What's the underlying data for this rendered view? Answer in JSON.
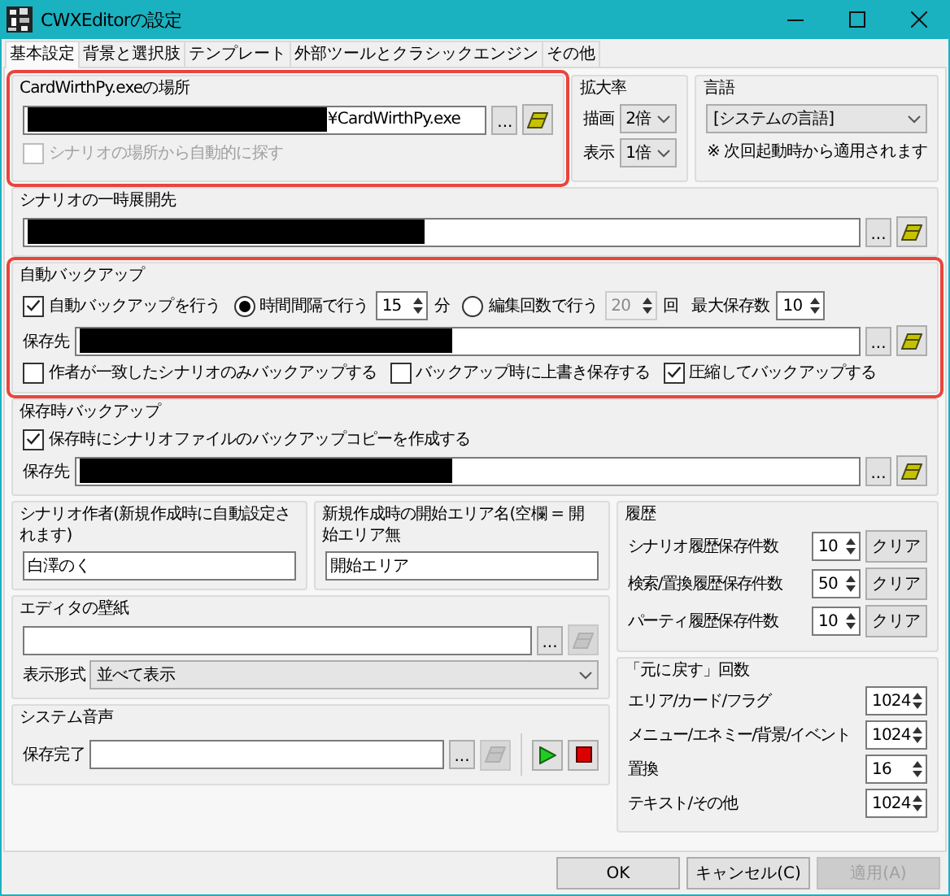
{
  "window": {
    "title": "CWXEditorの設定"
  },
  "tabs": [
    {
      "label": "基本設定",
      "selected": true
    },
    {
      "label": "背景と選択肢",
      "selected": false
    },
    {
      "label": "テンプレート",
      "selected": false
    },
    {
      "label": "外部ツールとクラシックエンジン",
      "selected": false
    },
    {
      "label": "その他",
      "selected": false
    }
  ],
  "exe_location": {
    "title": "CardWirthPy.exeの場所",
    "highlighted": true,
    "path": {
      "value": "¥CardWirthPy.exe",
      "redacted": true,
      "browse": "...",
      "open_disabled": false
    },
    "auto_find": {
      "label": "シナリオの場所から自動的に探す",
      "checked": false,
      "disabled": true
    }
  },
  "scale": {
    "title": "拡大率",
    "rows": [
      {
        "label": "描画",
        "value": "2倍"
      },
      {
        "label": "表示",
        "value": "1倍"
      }
    ]
  },
  "language": {
    "title": "言語",
    "value": "[システムの言語]",
    "note": "※ 次回起動時から適用されます"
  },
  "temp_dir": {
    "title": "シナリオの一時展開先",
    "highlighted": false,
    "path": {
      "redacted": true,
      "browse": "...",
      "open_disabled": false
    }
  },
  "auto_backup": {
    "title": "自動バックアップ",
    "highlighted": true,
    "enabled": {
      "label": "自動バックアップを行う",
      "checked": true
    },
    "modes": [
      {
        "label": "時間間隔で行う",
        "selected": true,
        "value": "15",
        "unit": "分"
      },
      {
        "label": "編集回数で行う",
        "selected": false,
        "value": "20",
        "unit": "回"
      }
    ],
    "max": {
      "label": "最大保存数",
      "value": "10"
    },
    "dest": {
      "label": "保存先",
      "redacted": true,
      "browse": "...",
      "open_disabled": false
    },
    "options": [
      {
        "label": "作者が一致したシナリオのみバックアップする",
        "checked": false
      },
      {
        "label": "バックアップ時に上書き保存する",
        "checked": false
      },
      {
        "label": "圧縮してバックアップする",
        "checked": true
      }
    ]
  },
  "save_backup": {
    "title": "保存時バックアップ",
    "highlighted": false,
    "option": {
      "label": "保存時にシナリオファイルのバックアップコピーを作成する",
      "checked": true
    },
    "dest": {
      "label": "保存先",
      "redacted": true,
      "browse": "...",
      "open_disabled": false
    }
  },
  "author": {
    "title": "シナリオ作者(新規作成時に自動設定されます)",
    "value": "白澤のく"
  },
  "start_area": {
    "title": "新規作成時の開始エリア名(空欄 = 開始エリア無",
    "value": "開始エリア"
  },
  "wallpaper": {
    "title": "エディタの壁紙",
    "path": {
      "browse": "...",
      "open_disabled": true
    },
    "style": {
      "label": "表示形式",
      "value": "並べて表示"
    }
  },
  "system_sound": {
    "title": "システム音声",
    "rows": [
      {
        "label": "保存完了",
        "path": {
          "browse": "...",
          "open_disabled": true
        }
      }
    ]
  },
  "history": {
    "title": "履歴",
    "rows": [
      {
        "label": "シナリオ履歴保存件数",
        "value": "10",
        "button": "クリア"
      },
      {
        "label": "検索/置換履歴保存件数",
        "value": "50",
        "button": "クリア"
      },
      {
        "label": "パーティ履歴保存件数",
        "value": "10",
        "button": "クリア"
      }
    ]
  },
  "undo": {
    "title": "「元に戻す」回数",
    "rows": [
      {
        "label": "エリア/カード/フラグ",
        "value": "1024"
      },
      {
        "label": "メニュー/エネミー/背景/イベント",
        "value": "1024"
      },
      {
        "label": "置換",
        "value": "16"
      },
      {
        "label": "テキスト/その他",
        "value": "1024"
      }
    ]
  },
  "buttons": [
    {
      "label": "OK",
      "disabled": false
    },
    {
      "label": "キャンセル(C)",
      "disabled": false
    },
    {
      "label": "適用(A)",
      "disabled": true
    }
  ]
}
